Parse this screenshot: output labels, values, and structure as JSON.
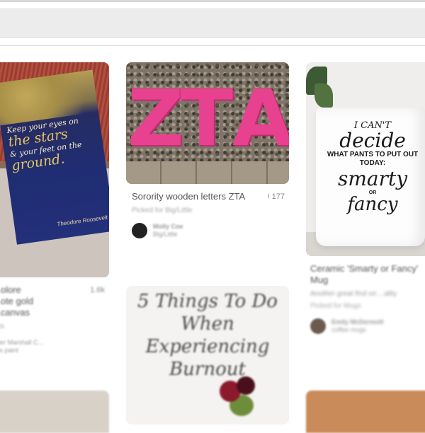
{
  "pins": {
    "col1": {
      "quote": [
        "Keep your eyes on",
        "the stars",
        "& your feet on the",
        "ground."
      ],
      "signature": "Theodore Roosevelt",
      "title": [
        "...olore",
        "...ote gold",
        "...canvas"
      ],
      "count": "1.6k",
      "subtitle": "...ts",
      "user": [
        "...ter Marshall C...",
        "...is paint"
      ]
    },
    "col2": {
      "letters": [
        "Z",
        "T",
        "A"
      ],
      "title": "Sorority wooden letters ZTA",
      "count": "177",
      "picked": "Picked for Big/Little",
      "user_name": "Molly Coe",
      "user_board": "Big/Little"
    },
    "col3": {
      "mug_lines": [
        "I CAN'T",
        "decide",
        "WHAT PANTS TO PUT OUT TODAY:",
        "smarty",
        "OR",
        "fancy"
      ],
      "title": "Ceramic 'Smarty or Fancy' Mug",
      "desc": "Another great find on ...ality",
      "picked": "Picked for Mugs",
      "user_name": "Emily McDermott",
      "user_board": "coffee mugs"
    },
    "row2": {
      "burnout_title": [
        "5 Things To Do",
        "When",
        "Experiencing",
        "Burnout"
      ]
    }
  }
}
